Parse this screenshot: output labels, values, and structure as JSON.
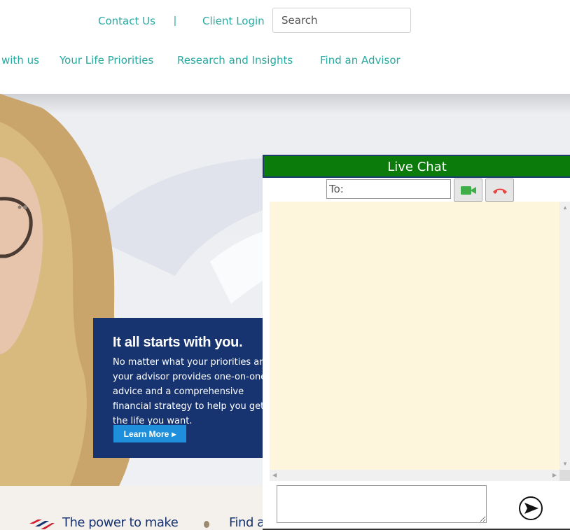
{
  "utility_nav": {
    "contact_label": "Contact Us",
    "separator": "|",
    "login_label": "Client Login",
    "search_placeholder": "Search"
  },
  "main_nav": {
    "items": [
      "with us",
      "Your Life Priorities",
      "Research and Insights",
      "Find an Advisor"
    ]
  },
  "promo": {
    "title": "It all starts with you.",
    "body": "No matter what your priorities are, your advisor provides one-on-one advice and a comprehensive financial strategy to help you get the life you want.",
    "button_label": "Learn More"
  },
  "lower_strip": {
    "item1": "The power to make",
    "item2": "Find a"
  },
  "chat": {
    "header": "Live Chat",
    "to_placeholder": "To:",
    "video_icon": "video-camera-icon",
    "hangup_icon": "phone-hangup-icon",
    "send_icon": "send-arrow-icon",
    "header_color": "#0b7b0b",
    "message_bg": "#fdf6dd"
  },
  "colors": {
    "nav_text": "#27a9a1",
    "promo_bg": "#173470",
    "button_bg": "#1f8fdc"
  }
}
